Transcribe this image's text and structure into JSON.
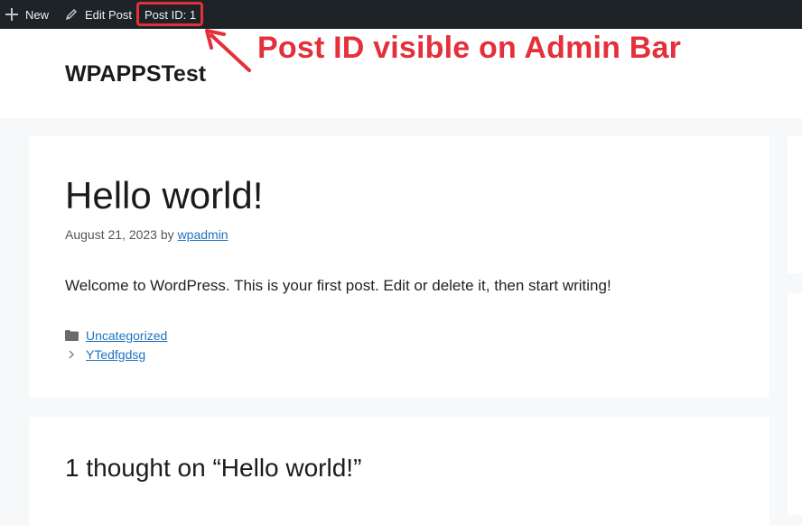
{
  "admin_bar": {
    "new_label": "New",
    "edit_label": "Edit Post",
    "post_id_label": "Post ID: 1"
  },
  "site": {
    "title": "WPAPPSTest"
  },
  "annotation": {
    "text": "Post ID visible on Admin Bar",
    "color": "#e3303a"
  },
  "post": {
    "title": "Hello world!",
    "date": "August 21, 2023",
    "by": "by",
    "author": "wpadmin",
    "content": "Welcome to WordPress. This is your first post. Edit or delete it, then start writing!",
    "category": "Uncategorized",
    "tag": "YTedfgdsg"
  },
  "comments": {
    "title": "1 thought on “Hello world!”"
  },
  "colors": {
    "admin_bar": "#1d2327",
    "link": "#1e73be",
    "highlight": "#e3303a"
  }
}
